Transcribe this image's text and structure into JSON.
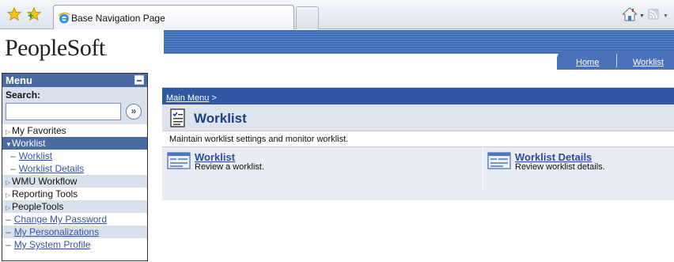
{
  "browser": {
    "tab_title": "Base Navigation Page"
  },
  "header": {
    "brand": "PeopleSoft",
    "brand_mark": ".",
    "nav_home": "Home",
    "nav_worklist": "Worklist"
  },
  "menu": {
    "title": "Menu",
    "search_label": "Search:",
    "search_value": "",
    "search_go": "»",
    "items": [
      {
        "label": "My Favorites"
      },
      {
        "label": "Worklist"
      },
      {
        "label": "Worklist"
      },
      {
        "label": "Worklist Details"
      },
      {
        "label": "WMU Workflow"
      },
      {
        "label": "Reporting Tools"
      },
      {
        "label": "PeopleTools"
      },
      {
        "label": "Change My Password"
      },
      {
        "label": "My Personalizations"
      },
      {
        "label": "My System Profile"
      }
    ]
  },
  "main": {
    "breadcrumb_link": "Main Menu",
    "breadcrumb_sep": ">",
    "title": "Worklist",
    "description": "Maintain worklist settings and monitor worklist.",
    "cards": [
      {
        "title": "Worklist",
        "desc": "Review a worklist."
      },
      {
        "title": "Worklist Details",
        "desc": "Review worklist details."
      }
    ]
  },
  "colors": {
    "menu_header": "#4a6aa3",
    "breadcrumb_bar": "#2f58a3",
    "link": "#3453a2"
  }
}
